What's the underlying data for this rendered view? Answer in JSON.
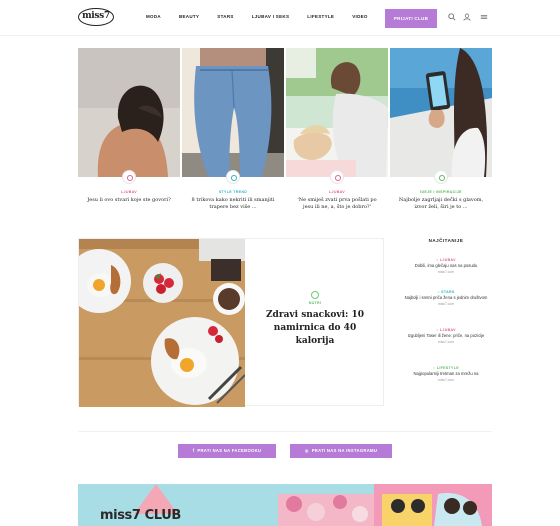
{
  "header": {
    "logo": "miss7",
    "nav": [
      "MODA",
      "BEAUTY",
      "STARS",
      "LJUBAV I SEKS",
      "LIFESTYLE",
      "VIDEO"
    ],
    "club_button": "PRIJATI CLUB",
    "icons": [
      "search-icon",
      "user-icon",
      "menu-icon"
    ]
  },
  "cards": [
    {
      "category": "LJUBAV",
      "category_color": "#e35f8c",
      "title": "Jesu li ovo stvari koje ste govori?"
    },
    {
      "category": "STYLE TREND",
      "category_color": "#2bb5c9",
      "title": "8 trikova kako nekriti ili smanjiti trapere bez više ..."
    },
    {
      "category": "LJUBAV",
      "category_color": "#e35f8c",
      "title": "'Ne smiješ zvati prva pošlati po jesu ili ne, a, što je dobro?'"
    },
    {
      "category": "IDEJE I INSPIRACIJE",
      "category_color": "#5cb862",
      "title": "Najbolje zagrljaji dečki s glavom, izvor želi, širi je to ..."
    }
  ],
  "feature": {
    "category": "NUTRI",
    "title": "Zdravi snackovi: 10 namirnica do 40 kalorija"
  },
  "sidebar": {
    "heading": "NAJČITANIJE",
    "items": [
      {
        "category": "LJUBAV",
        "color": "#e35f8c",
        "title": "Dobili, ima glečaju nas na posudu",
        "author": "miss7.com"
      },
      {
        "category": "STARS",
        "color": "#2bb5c9",
        "title": "Najbolji i sretni priča žena s jednim društvom",
        "author": "miss7.com"
      },
      {
        "category": "LJUBAV",
        "color": "#e35f8c",
        "title": "Izgubljeni Taser ili žene: priče, na pozicije",
        "author": "miss7.com"
      },
      {
        "category": "LIFESTYLE",
        "color": "#5cb862",
        "title": "Najpopularniji tretman za mrežu na",
        "author": "miss7.com"
      }
    ]
  },
  "social": {
    "facebook": "PRATI NAS NA FACEBOOKU",
    "instagram": "PRATI NAS NA INSTAGRAMU"
  },
  "club": {
    "logo": "miss7 CLUB"
  }
}
